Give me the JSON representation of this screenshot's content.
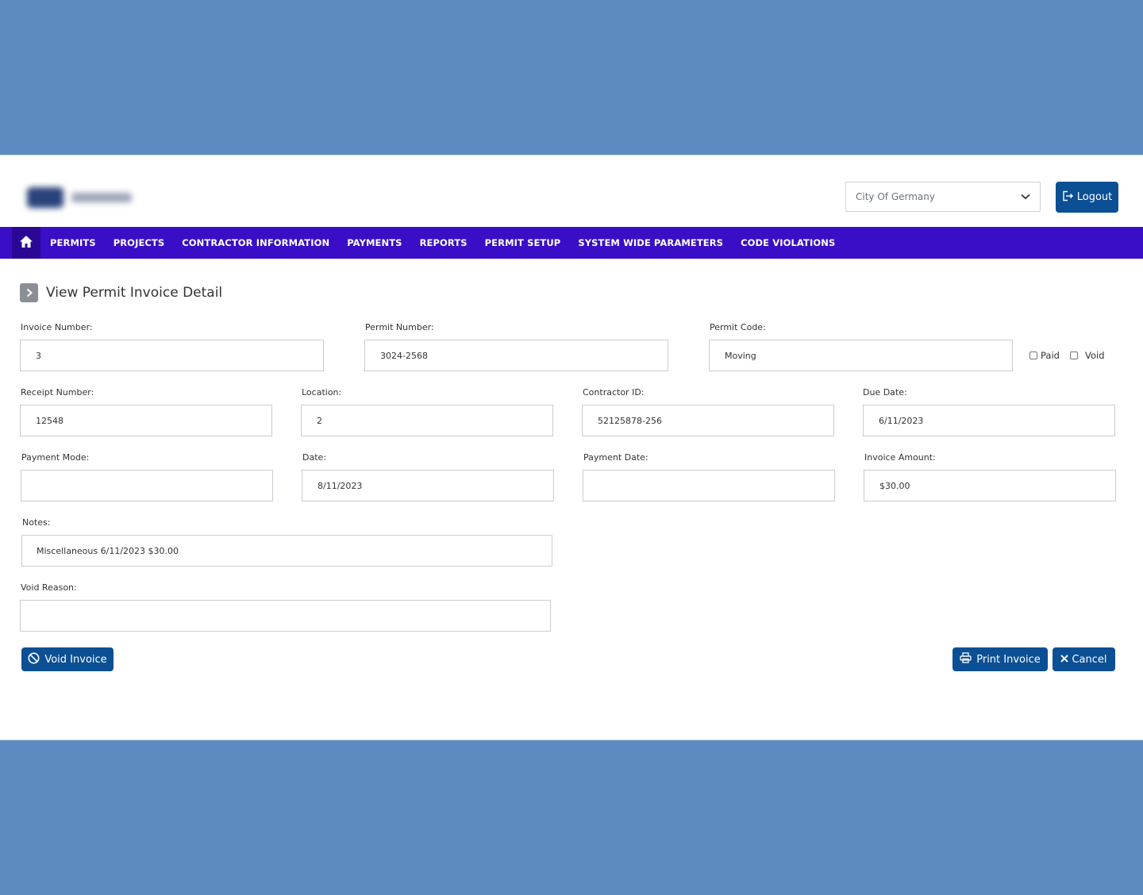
{
  "header": {
    "city_select": {
      "value": "City Of Germany",
      "icon": "chevron-down-icon"
    },
    "logout_label": "Logout"
  },
  "nav": {
    "items": [
      {
        "label": "PERMITS"
      },
      {
        "label": "PROJECTS"
      },
      {
        "label": "CONTRACTOR INFORMATION"
      },
      {
        "label": "PAYMENTS"
      },
      {
        "label": "REPORTS"
      },
      {
        "label": "PERMIT SETUP"
      },
      {
        "label": "SYSTEM WIDE PARAMETERS"
      },
      {
        "label": "CODE VIOLATIONS"
      }
    ]
  },
  "page": {
    "title": "View Permit Invoice Detail"
  },
  "form": {
    "invoice_number": {
      "label": "Invoice Number:",
      "value": "3"
    },
    "permit_number": {
      "label": "Permit Number:",
      "value": "3024-2568"
    },
    "permit_code": {
      "label": "Permit Code:",
      "value": "Moving"
    },
    "paid": {
      "label": "Paid",
      "checked": false
    },
    "void": {
      "label": "Void",
      "checked": false
    },
    "receipt_number": {
      "label": "Receipt Number:",
      "value": "12548"
    },
    "location": {
      "label": "Location:",
      "value": "2"
    },
    "contractor_id": {
      "label": "Contractor ID:",
      "value": "52125878-256"
    },
    "due_date": {
      "label": "Due Date:",
      "value": "6/11/2023"
    },
    "payment_mode": {
      "label": "Payment Mode:",
      "value": ""
    },
    "date": {
      "label": "Date:",
      "value": "8/11/2023"
    },
    "payment_date": {
      "label": "Payment Date:",
      "value": ""
    },
    "invoice_amount": {
      "label": "Invoice Amount:",
      "value": "$30.00"
    },
    "notes": {
      "label": "Notes:",
      "value": "Miscellaneous 6/11/2023  $30.00"
    },
    "void_reason": {
      "label": "Void Reason:",
      "value": ""
    }
  },
  "actions": {
    "void_invoice": "Void Invoice",
    "print_invoice": "Print Invoice",
    "cancel": "Cancel"
  },
  "colors": {
    "nav_bg": "#3a0ec6",
    "button_bg": "#0b4f94",
    "page_bg": "#5b8bc0"
  }
}
